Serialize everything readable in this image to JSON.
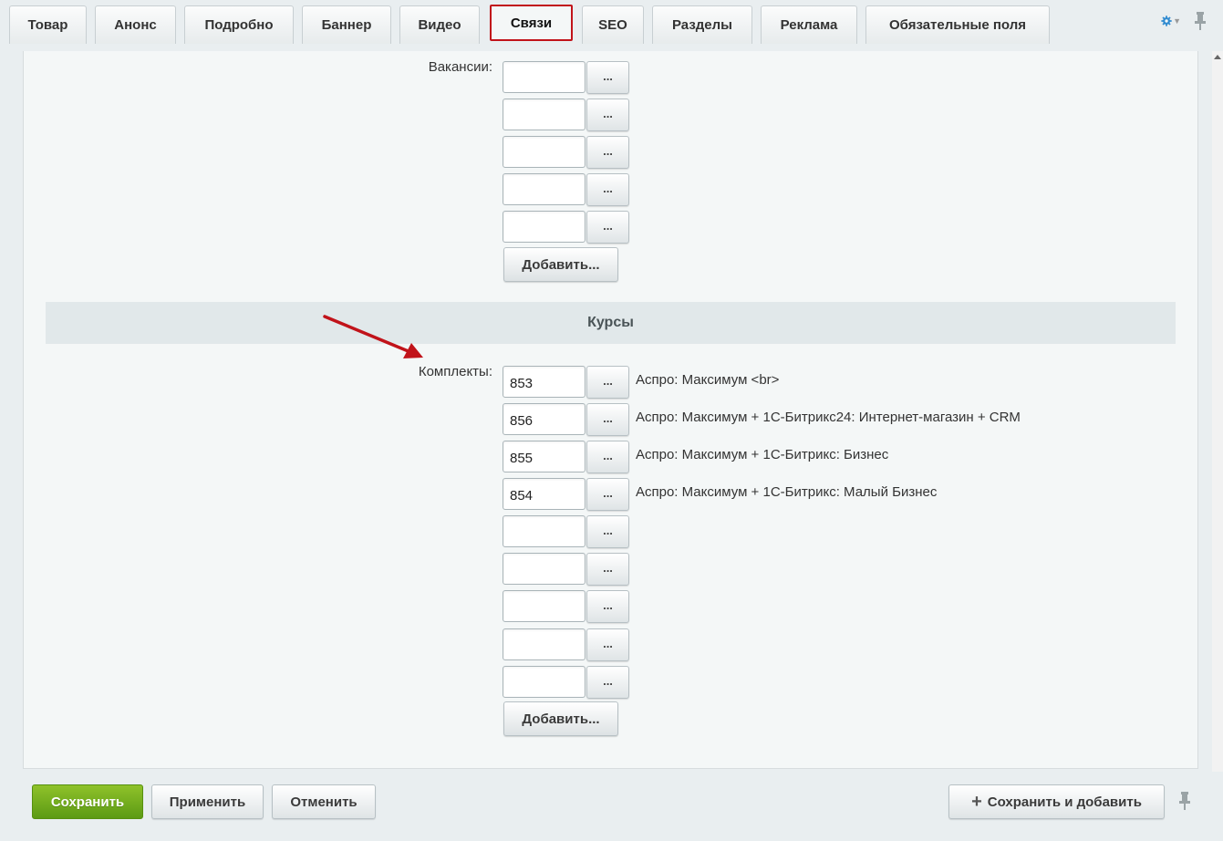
{
  "tabs": [
    {
      "label": "Товар"
    },
    {
      "label": "Анонс"
    },
    {
      "label": "Подробно"
    },
    {
      "label": "Баннер"
    },
    {
      "label": "Видео"
    },
    {
      "label": "Связи"
    },
    {
      "label": "SEO"
    },
    {
      "label": "Разделы"
    },
    {
      "label": "Реклама"
    },
    {
      "label": "Обязательные поля"
    }
  ],
  "active_tab": "Связи",
  "vacancies": {
    "label": "Вакансии:",
    "values": [
      "",
      "",
      "",
      "",
      ""
    ],
    "more_label": "...",
    "add_label": "Добавить..."
  },
  "section": {
    "title": "Курсы"
  },
  "kits": {
    "label": "Комплекты:",
    "rows": [
      {
        "value": "853",
        "name": "Аспро: Максимум <br>"
      },
      {
        "value": "856",
        "name": "Аспро: Максимум + 1С-Битрикс24: Интернет-магазин + CRM"
      },
      {
        "value": "855",
        "name": "Аспро: Максимум + 1С-Битрикс: Бизнес"
      },
      {
        "value": "854",
        "name": "Аспро: Максимум + 1С-Битрикс: Малый Бизнес"
      },
      {
        "value": "",
        "name": ""
      },
      {
        "value": "",
        "name": ""
      },
      {
        "value": "",
        "name": ""
      },
      {
        "value": "",
        "name": ""
      },
      {
        "value": "",
        "name": ""
      }
    ],
    "more_label": "...",
    "add_label": "Добавить..."
  },
  "footer": {
    "save": "Сохранить",
    "apply": "Применить",
    "cancel": "Отменить",
    "save_add": "Сохранить и добавить"
  },
  "colors": {
    "accent_green": "#6aa81a",
    "active_tab_border": "#c1131a",
    "annotation_arrow": "#c1131a",
    "gear": "#2f8ad0"
  },
  "icons": {
    "settings": "gear-icon",
    "pin": "pin-icon",
    "add": "plus-icon",
    "annotation": "arrow-icon"
  }
}
